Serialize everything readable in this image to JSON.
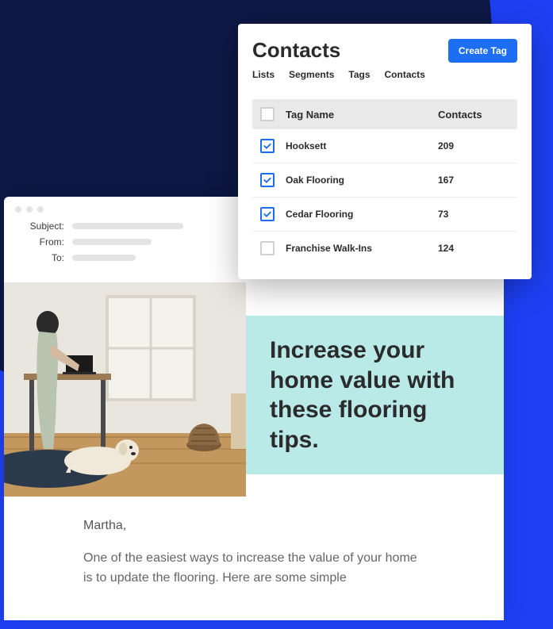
{
  "contacts": {
    "title": "Contacts",
    "create_tag_label": "Create Tag",
    "tabs": [
      "Lists",
      "Segments",
      "Tags",
      "Contacts"
    ],
    "columns": {
      "name": "Tag Name",
      "contacts": "Contacts"
    },
    "rows": [
      {
        "name": "Hooksett",
        "contacts": "209",
        "checked": true
      },
      {
        "name": "Oak Flooring",
        "contacts": "167",
        "checked": true
      },
      {
        "name": "Cedar Flooring",
        "contacts": "73",
        "checked": true
      },
      {
        "name": "Franchise Walk-Ins",
        "contacts": "124",
        "checked": false
      }
    ]
  },
  "email": {
    "labels": {
      "subject": "Subject:",
      "from": "From:",
      "to": "To:"
    },
    "hero_title": "Increase your home value with these flooring tips.",
    "greeting": "Martha,",
    "body": "One of the easiest ways to increase the value of your home is to update the flooring. Here are some simple"
  },
  "colors": {
    "accent": "#1e6ef5",
    "hero_bg": "#baeae7",
    "bg_dark": "#0e1845",
    "bg_blue": "#1e40f5"
  }
}
